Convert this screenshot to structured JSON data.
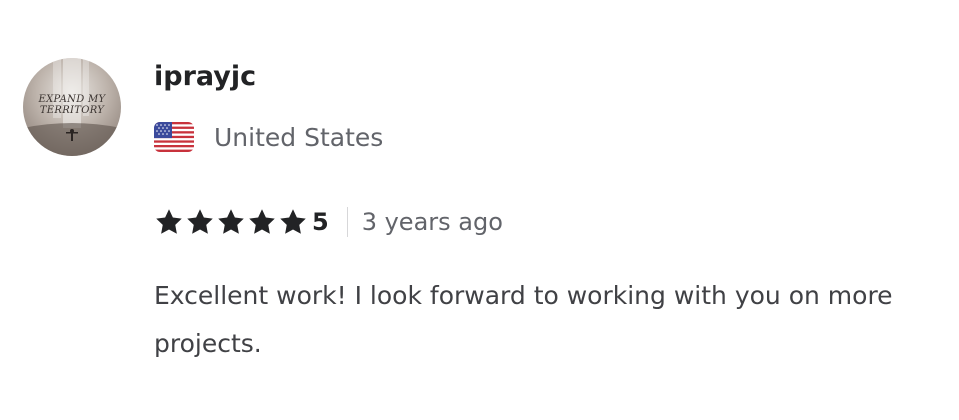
{
  "review": {
    "avatar": {
      "text_line_1": "EXPAND MY",
      "text_line_2": "TERRITORY"
    },
    "username": "iprayjc",
    "country": {
      "flag_icon": "us-flag-icon",
      "name": "United States"
    },
    "rating": {
      "value": "5",
      "stars": 5,
      "star_icon": "star-icon",
      "star_color": "#222325"
    },
    "time_ago": "3 years ago",
    "comment": "Excellent work! I look forward to working with you on more projects."
  }
}
